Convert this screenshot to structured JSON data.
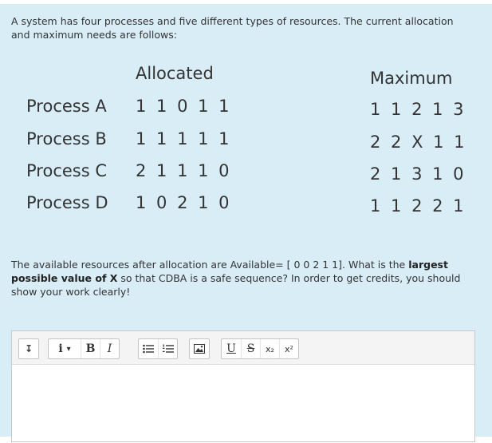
{
  "intro": {
    "text": "A system has four processes and five different types of resources. The current allocation and maximum needs are follows:"
  },
  "table": {
    "allocated_header": "Allocated",
    "maximum_header": "Maximum",
    "rows": [
      {
        "process": "Process A",
        "allocated": "1 1 0 1 1",
        "maximum": "1 1 2 1 3"
      },
      {
        "process": "Process B",
        "allocated": "1 1 1 1 1",
        "maximum": "2 2 X 1 1"
      },
      {
        "process": "Process C",
        "allocated": "2 1 1 1 0",
        "maximum": "2 1 3 1 0"
      },
      {
        "process": "Process D",
        "allocated": "1 0 2 1 0",
        "maximum": "1 1 2 2 1"
      }
    ]
  },
  "question": {
    "part1": "The available resources after allocation are Available= [ 0 0 2 1 1]. What is the ",
    "bold1": "largest possible value of X",
    "part2": " so that CDBA is a safe sequence? In order to get credits, you should show your work clearly!"
  },
  "toolbar": {
    "collapse_glyph": "↧",
    "info_glyph": "i",
    "dropdown_glyph": "▾",
    "bold_label": "B",
    "italic_label": "I",
    "underline_label": "U",
    "strike_label": "S",
    "subscript_label": "x₂",
    "superscript_label": "x²"
  },
  "icons": {
    "collapse": "collapse-arrow-icon",
    "info": "info-icon",
    "unordered_list": "unordered-list-icon",
    "ordered_list": "ordered-list-icon",
    "image": "image-icon"
  },
  "colors": {
    "panel_bg": "#d9edf7",
    "text": "#333333",
    "toolbar_bg": "#f4f4f4"
  }
}
